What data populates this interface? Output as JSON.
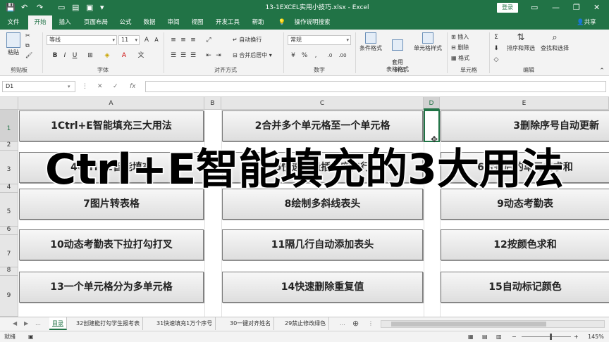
{
  "window": {
    "title": "13-1EXCEL实用小技巧.xlsx  -  Excel",
    "login": "登录"
  },
  "menu": {
    "items": [
      "文件",
      "开始",
      "插入",
      "页面布局",
      "公式",
      "数据",
      "审阅",
      "视图",
      "开发工具",
      "帮助",
      "操作说明搜索"
    ],
    "active_index": 1,
    "share": "共享"
  },
  "ribbon": {
    "clipboard": {
      "paste": "粘贴",
      "label": "剪贴板"
    },
    "font": {
      "name": "等线",
      "size": "11",
      "label": "字体"
    },
    "alignment": {
      "wrap": "自动换行",
      "merge": "合并后居中",
      "label": "对齐方式"
    },
    "number": {
      "format": "常规",
      "label": "数字"
    },
    "styles": {
      "cond": "条件格式",
      "table": "套用\n表格格式",
      "cell": "单元格样式",
      "label": "样式"
    },
    "cells": {
      "insert": "插入",
      "delete": "删除",
      "format": "格式",
      "label": "单元格"
    },
    "editing": {
      "sort": "排序和筛选",
      "find": "查找和选择",
      "label": "编辑"
    }
  },
  "formula_bar": {
    "name_box": "D1",
    "fx": "fx",
    "value": ""
  },
  "sheet": {
    "columns": [
      "A",
      "B",
      "C",
      "D",
      "E"
    ],
    "selected_column": "D",
    "rows": [
      "1",
      "2",
      "3",
      "4",
      "5",
      "6",
      "7",
      "8",
      "9"
    ],
    "buttons": [
      "1Ctrl+E智能填充三大用法",
      "2合并多个单元格至一个单元格",
      "3删除序号自动更新",
      "4Ctrl+E智能填充",
      "5快速批量插入空白行",
      "6合并后的单元格求和",
      "7图片转表格",
      "8绘制多斜线表头",
      "9动态考勤表",
      "10动态考勤表下拉打勾打叉",
      "11隔几行自动添加表头",
      "12按颜色求和",
      "13一个单元格分为多单元格",
      "14快速删除重复值",
      "15自动标记颜色"
    ]
  },
  "overlay": {
    "text": "Ctrl+E智能填充的3大用法"
  },
  "tabs": {
    "items": [
      "目录",
      "32创建能打勾学生报考表",
      "31快速填充1万个序号",
      "30一键对齐姓名",
      "29禁止修改绿色"
    ],
    "active_index": 0,
    "ellipsis": "..."
  },
  "status": {
    "mode": "就绪",
    "zoom": "145%"
  },
  "colors": {
    "accent": "#217346",
    "button_face": "#e6e6e6"
  }
}
